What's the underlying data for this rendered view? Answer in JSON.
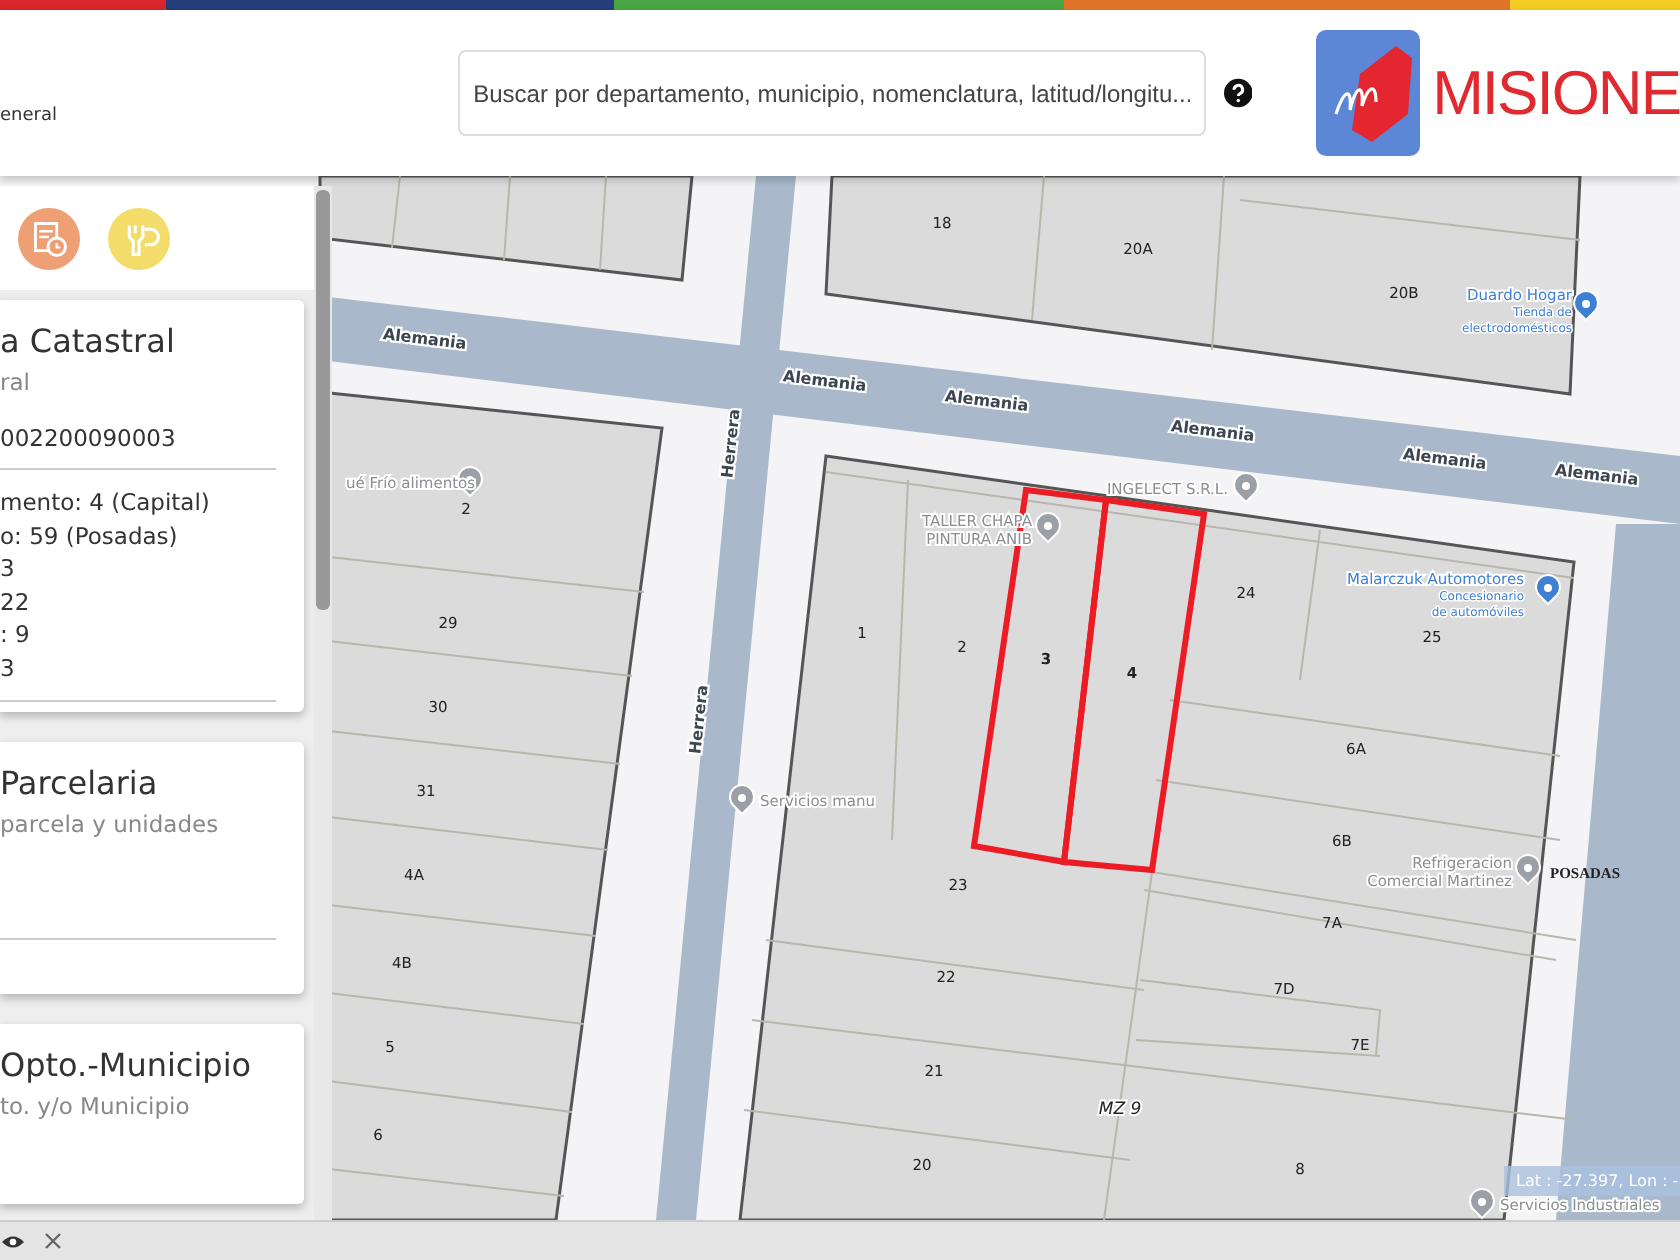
{
  "header": {
    "subtitle": "eneral",
    "search": {
      "placeholder": "Buscar por departamento, municipio, nomenclatura, latitud/longitu..."
    },
    "logo_text": "MISIONE"
  },
  "panel": {
    "cards": [
      {
        "title": "a Catastral",
        "subtitle": "ral",
        "code": "002200090003",
        "lines": [
          "mento: 4 (Capital)",
          "o: 59 (Posadas)",
          "3",
          "22",
          ": 9",
          "3"
        ]
      },
      {
        "title": "Parcelaria",
        "subtitle": "parcela y unidades"
      },
      {
        "title": "Opto.-Municipio",
        "subtitle": "to. y/o Municipio"
      }
    ]
  },
  "map": {
    "streets": [
      "Alemania",
      "Alemania",
      "Alemania",
      "Alemania",
      "Alemania",
      "Alemania",
      "Herrera",
      "Herrera"
    ],
    "parcels": [
      {
        "label": "18",
        "selected": false
      },
      {
        "label": "20A",
        "selected": false
      },
      {
        "label": "20B",
        "selected": false
      },
      {
        "label": "2",
        "selected": false
      },
      {
        "label": "29",
        "selected": false
      },
      {
        "label": "30",
        "selected": false
      },
      {
        "label": "31",
        "selected": false
      },
      {
        "label": "4A",
        "selected": false
      },
      {
        "label": "4B",
        "selected": false
      },
      {
        "label": "5",
        "selected": false
      },
      {
        "label": "6",
        "selected": false
      },
      {
        "label": "1",
        "selected": false
      },
      {
        "label": "2",
        "selected": false
      },
      {
        "label": "3",
        "selected": true
      },
      {
        "label": "4",
        "selected": true
      },
      {
        "label": "24",
        "selected": false
      },
      {
        "label": "25",
        "selected": false
      },
      {
        "label": "6A",
        "selected": false
      },
      {
        "label": "6B",
        "selected": false
      },
      {
        "label": "23",
        "selected": false
      },
      {
        "label": "7A",
        "selected": false
      },
      {
        "label": "22",
        "selected": false
      },
      {
        "label": "7D",
        "selected": false
      },
      {
        "label": "7E",
        "selected": false
      },
      {
        "label": "21",
        "selected": false
      },
      {
        "label": "20",
        "selected": false
      },
      {
        "label": "8",
        "selected": false
      }
    ],
    "places": [
      {
        "kind": "place",
        "name_lines": [
          "ué Frío alimentos"
        ]
      },
      {
        "kind": "place",
        "name_lines": [
          "TALLER CHAPA",
          "PINTURA ANIB"
        ]
      },
      {
        "kind": "place",
        "name_lines": [
          "INGELECT S.R.L."
        ]
      },
      {
        "kind": "store",
        "name_lines": [
          "Duardo Hogar"
        ],
        "detail_lines": [
          "Tienda de",
          "electrodomésticos"
        ]
      },
      {
        "kind": "store",
        "name_lines": [
          "Malarczuk Automotores"
        ],
        "detail_lines": [
          "Concesionario",
          "de automóviles"
        ]
      },
      {
        "kind": "place",
        "name_lines": [
          "Servicios manu"
        ]
      },
      {
        "kind": "place",
        "name_lines": [
          "Refrigeracion",
          "Comercial Martinez"
        ]
      },
      {
        "kind": "place",
        "name_lines": [
          "Servicios Industriales"
        ]
      }
    ],
    "city_label": "POSADAS",
    "block_label": "MZ 9",
    "coordinates": "Lat : -27.397, Lon : -"
  }
}
